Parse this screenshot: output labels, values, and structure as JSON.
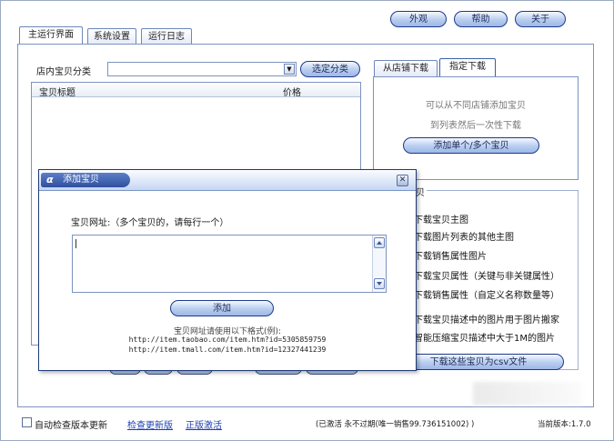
{
  "header": {
    "external_label": "外观",
    "help_label": "帮助",
    "about_label": "关于"
  },
  "tabs": [
    {
      "label": "主运行界面"
    },
    {
      "label": "系统设置"
    },
    {
      "label": "运行日志"
    }
  ],
  "left_panel": {
    "category_label": "店内宝贝分类",
    "select_category_button": "选定分类",
    "columns": [
      "宝贝标题",
      "价格"
    ]
  },
  "right_tabs": [
    {
      "label": "从店铺下载"
    },
    {
      "label": "指定下载"
    }
  ],
  "right_panel": {
    "info_line1": "可以从不同店铺添加宝贝",
    "info_line2": "到列表然后一次性下载",
    "add_items_button": "添加单个/多个宝贝"
  },
  "options": {
    "group_title_fragment": "贝",
    "items": [
      "下载宝贝主图",
      "下载图片列表的其他主图",
      "下载销售属性图片",
      "下载宝贝属性（关键与非关键属性）",
      "下载销售属性（自定义名称数量等）",
      "下载宝贝描述中的图片用于图片搬家",
      "智能压缩宝贝描述中大于1M的图片"
    ],
    "download_csv_button": "下载这些宝贝为csv文件"
  },
  "dialog": {
    "title": "添加宝贝",
    "url_label": "宝贝网址:（多个宝贝的，请每行一个）",
    "add_button": "添加",
    "format_hint": "宝贝网址请使用以下格式(例):",
    "example_taobao": "http://item.taobao.com/item.htm?id=5305859759",
    "example_tmall": "http://item.tmall.com/item.htm?id=12327441239"
  },
  "status_bar": {
    "auto_check_label": "自动检查版本更新",
    "check_update_link": "检查更新版",
    "activate_link": "正版激活",
    "activation_status": "(已激活 永不过期(唯一销售99.736151002) )",
    "version_text": "当前版本:1.7.0"
  },
  "colors": {
    "accent_blue": "#1e3a8a",
    "dialog_title_bg": "#2f4f9e",
    "window_border": "#9aa9c4"
  }
}
